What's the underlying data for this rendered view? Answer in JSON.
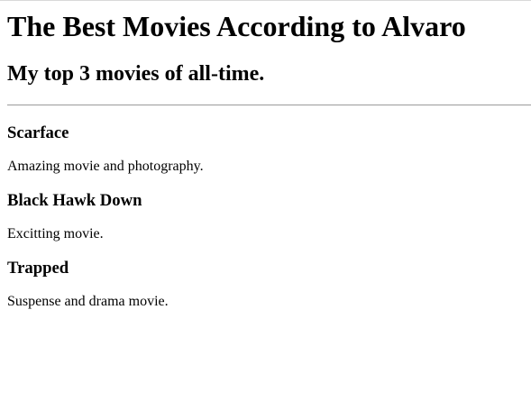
{
  "header": {
    "title": "The Best Movies According to Alvaro",
    "subtitle": "My top 3 movies of all-time."
  },
  "movies": [
    {
      "title": "Scarface",
      "description": "Amazing movie and photography."
    },
    {
      "title": "Black Hawk Down",
      "description": "Excitting movie."
    },
    {
      "title": "Trapped",
      "description": "Suspense and drama movie."
    }
  ]
}
